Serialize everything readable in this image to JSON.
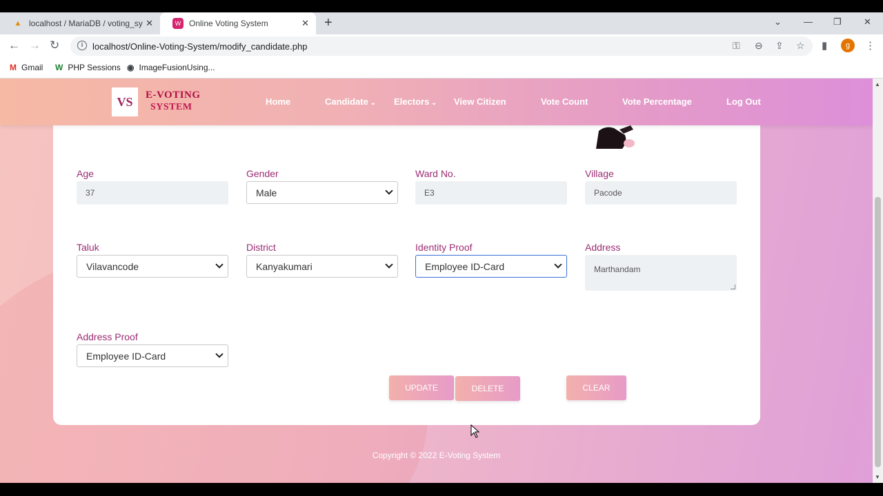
{
  "browser": {
    "tabs": [
      {
        "title": "localhost / MariaDB / voting_syst",
        "icon": "phpmyadmin-icon"
      },
      {
        "title": "Online Voting System",
        "icon": "site-icon"
      }
    ],
    "url": "localhost/Online-Voting-System/modify_candidate.php",
    "bookmarks": [
      {
        "label": "Gmail",
        "icon": "gmail-icon"
      },
      {
        "label": "PHP Sessions",
        "icon": "w-icon"
      },
      {
        "label": "ImageFusionUsing...",
        "icon": "globe-icon"
      }
    ],
    "profile_initial": "g"
  },
  "site": {
    "logo_initials": "VS",
    "logo_line1": "E-VOTING",
    "logo_line2": "SYSTEM",
    "nav": [
      "Home",
      "Candidate",
      "Electors",
      "View Citizen",
      "Vote Count",
      "Vote Percentage",
      "Log Out"
    ]
  },
  "form": {
    "age": {
      "label": "Age",
      "value": "37"
    },
    "gender": {
      "label": "Gender",
      "value": "Male"
    },
    "ward": {
      "label": "Ward No.",
      "value": "E3"
    },
    "village": {
      "label": "Village",
      "value": "Pacode"
    },
    "taluk": {
      "label": "Taluk",
      "value": "Vilavancode"
    },
    "district": {
      "label": "District",
      "value": "Kanyakumari"
    },
    "identity_proof": {
      "label": "Identity Proof",
      "value": "Employee ID-Card"
    },
    "address": {
      "label": "Address",
      "value": "Marthandam"
    },
    "address_proof": {
      "label": "Address Proof",
      "value": "Employee ID-Card"
    }
  },
  "buttons": {
    "update": "UPDATE",
    "delete": "DELETE",
    "clear": "CLEAR"
  },
  "footer": "Copyright © 2022 E-Voting System",
  "colors": {
    "label": "#9b2c73",
    "brand": "#b01040",
    "focus": "#3b6fd8"
  }
}
